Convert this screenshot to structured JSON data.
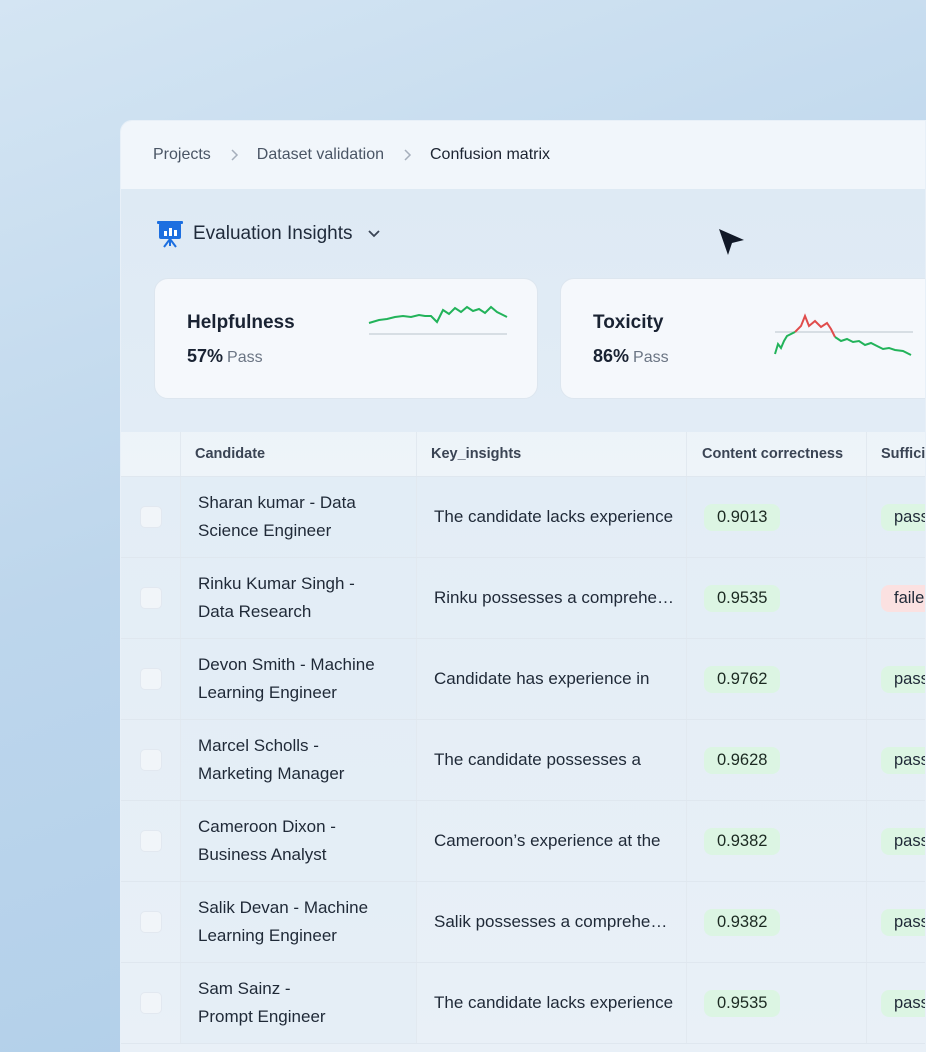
{
  "breadcrumb": {
    "items": [
      "Projects",
      "Dataset validation"
    ],
    "current": "Confusion matrix"
  },
  "header": {
    "title": "Evaluation Insights",
    "icon": "presentation-chart-icon"
  },
  "cards": [
    {
      "title": "Helpfulness",
      "value": "57%",
      "status": "Pass",
      "line_color": "#22b35a"
    },
    {
      "title": "Toxicity",
      "value": "86%",
      "status": "Pass",
      "line_color": "#22b35a",
      "alert_color": "#e04c4c"
    }
  ],
  "table": {
    "columns": [
      "Candidate",
      "Key_insights",
      "Content correctness",
      "Sufficiency"
    ],
    "rows": [
      {
        "candidate": [
          "Sharan kumar - Data",
          "Science  Engineer"
        ],
        "insight": "The candidate lacks experience",
        "score": "0.9013",
        "sufficiency": "pass"
      },
      {
        "candidate": [
          "Rinku Kumar Singh -",
          "Data Research"
        ],
        "insight": "Rinku possesses a comprehensive",
        "score": "0.9535",
        "sufficiency": "failed"
      },
      {
        "candidate": [
          "Devon Smith - Machine",
          "Learning Engineer"
        ],
        "insight": "Candidate has experience in",
        "score": "0.9762",
        "sufficiency": "pass"
      },
      {
        "candidate": [
          "Marcel Scholls -",
          "Marketing Manager"
        ],
        "insight": "The candidate possesses a",
        "score": "0.9628",
        "sufficiency": "pass"
      },
      {
        "candidate": [
          "Cameroon Dixon -",
          "Business Analyst"
        ],
        "insight": "Cameroon’s experience at the",
        "score": "0.9382",
        "sufficiency": "pass"
      },
      {
        "candidate": [
          "Salik Devan - Machine",
          "Learning Engineer"
        ],
        "insight": "Salik possesses a comprehensive",
        "score": "0.9382",
        "sufficiency": "pass"
      },
      {
        "candidate": [
          "Sam Sainz -",
          "Prompt Engineer"
        ],
        "insight": "The candidate lacks experience",
        "score": "0.9535",
        "sufficiency": "pass"
      }
    ]
  },
  "colors": {
    "pass_bg": "#dcf5e3",
    "fail_bg": "#fbe1e1",
    "accent": "#1d6fe0"
  }
}
